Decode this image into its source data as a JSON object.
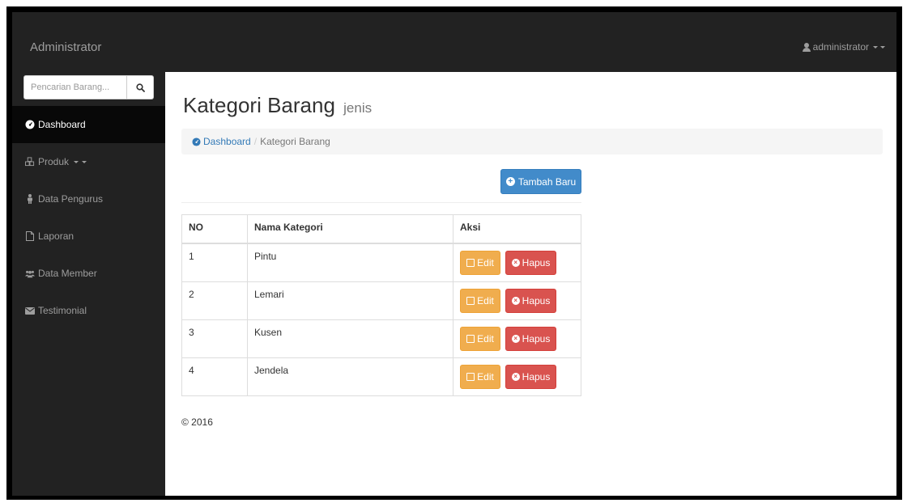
{
  "navbar": {
    "brand": "Administrator",
    "user_label": "administrator"
  },
  "sidebar": {
    "search_placeholder": "Pencarian Barang...",
    "items": [
      {
        "label": "Dashboard",
        "icon": "dashboard-icon",
        "active": true
      },
      {
        "label": "Produk",
        "icon": "cubes-icon",
        "active": false
      },
      {
        "label": "Data Pengurus",
        "icon": "user-icon",
        "active": false
      },
      {
        "label": "Laporan",
        "icon": "file-icon",
        "active": false
      },
      {
        "label": "Data Member",
        "icon": "users-icon",
        "active": false
      },
      {
        "label": "Testimonial",
        "icon": "envelope-icon",
        "active": false
      }
    ]
  },
  "page": {
    "title": "Kategori Barang",
    "subtitle": "jenis",
    "breadcrumb": {
      "home": "Dashboard",
      "current": "Kategori Barang"
    },
    "add_button": "Tambah Baru"
  },
  "table": {
    "headers": [
      "NO",
      "Nama Kategori",
      "Aksi"
    ],
    "rows": [
      {
        "no": "1",
        "name": "Pintu"
      },
      {
        "no": "2",
        "name": "Lemari"
      },
      {
        "no": "3",
        "name": "Kusen"
      },
      {
        "no": "4",
        "name": "Jendela"
      }
    ],
    "edit_label": "Edit",
    "delete_label": "Hapus"
  },
  "footer": "© 2016",
  "colors": {
    "navbar": "#222222",
    "primary": "#428bca",
    "warning": "#f0ad4e",
    "danger": "#d9534f"
  }
}
